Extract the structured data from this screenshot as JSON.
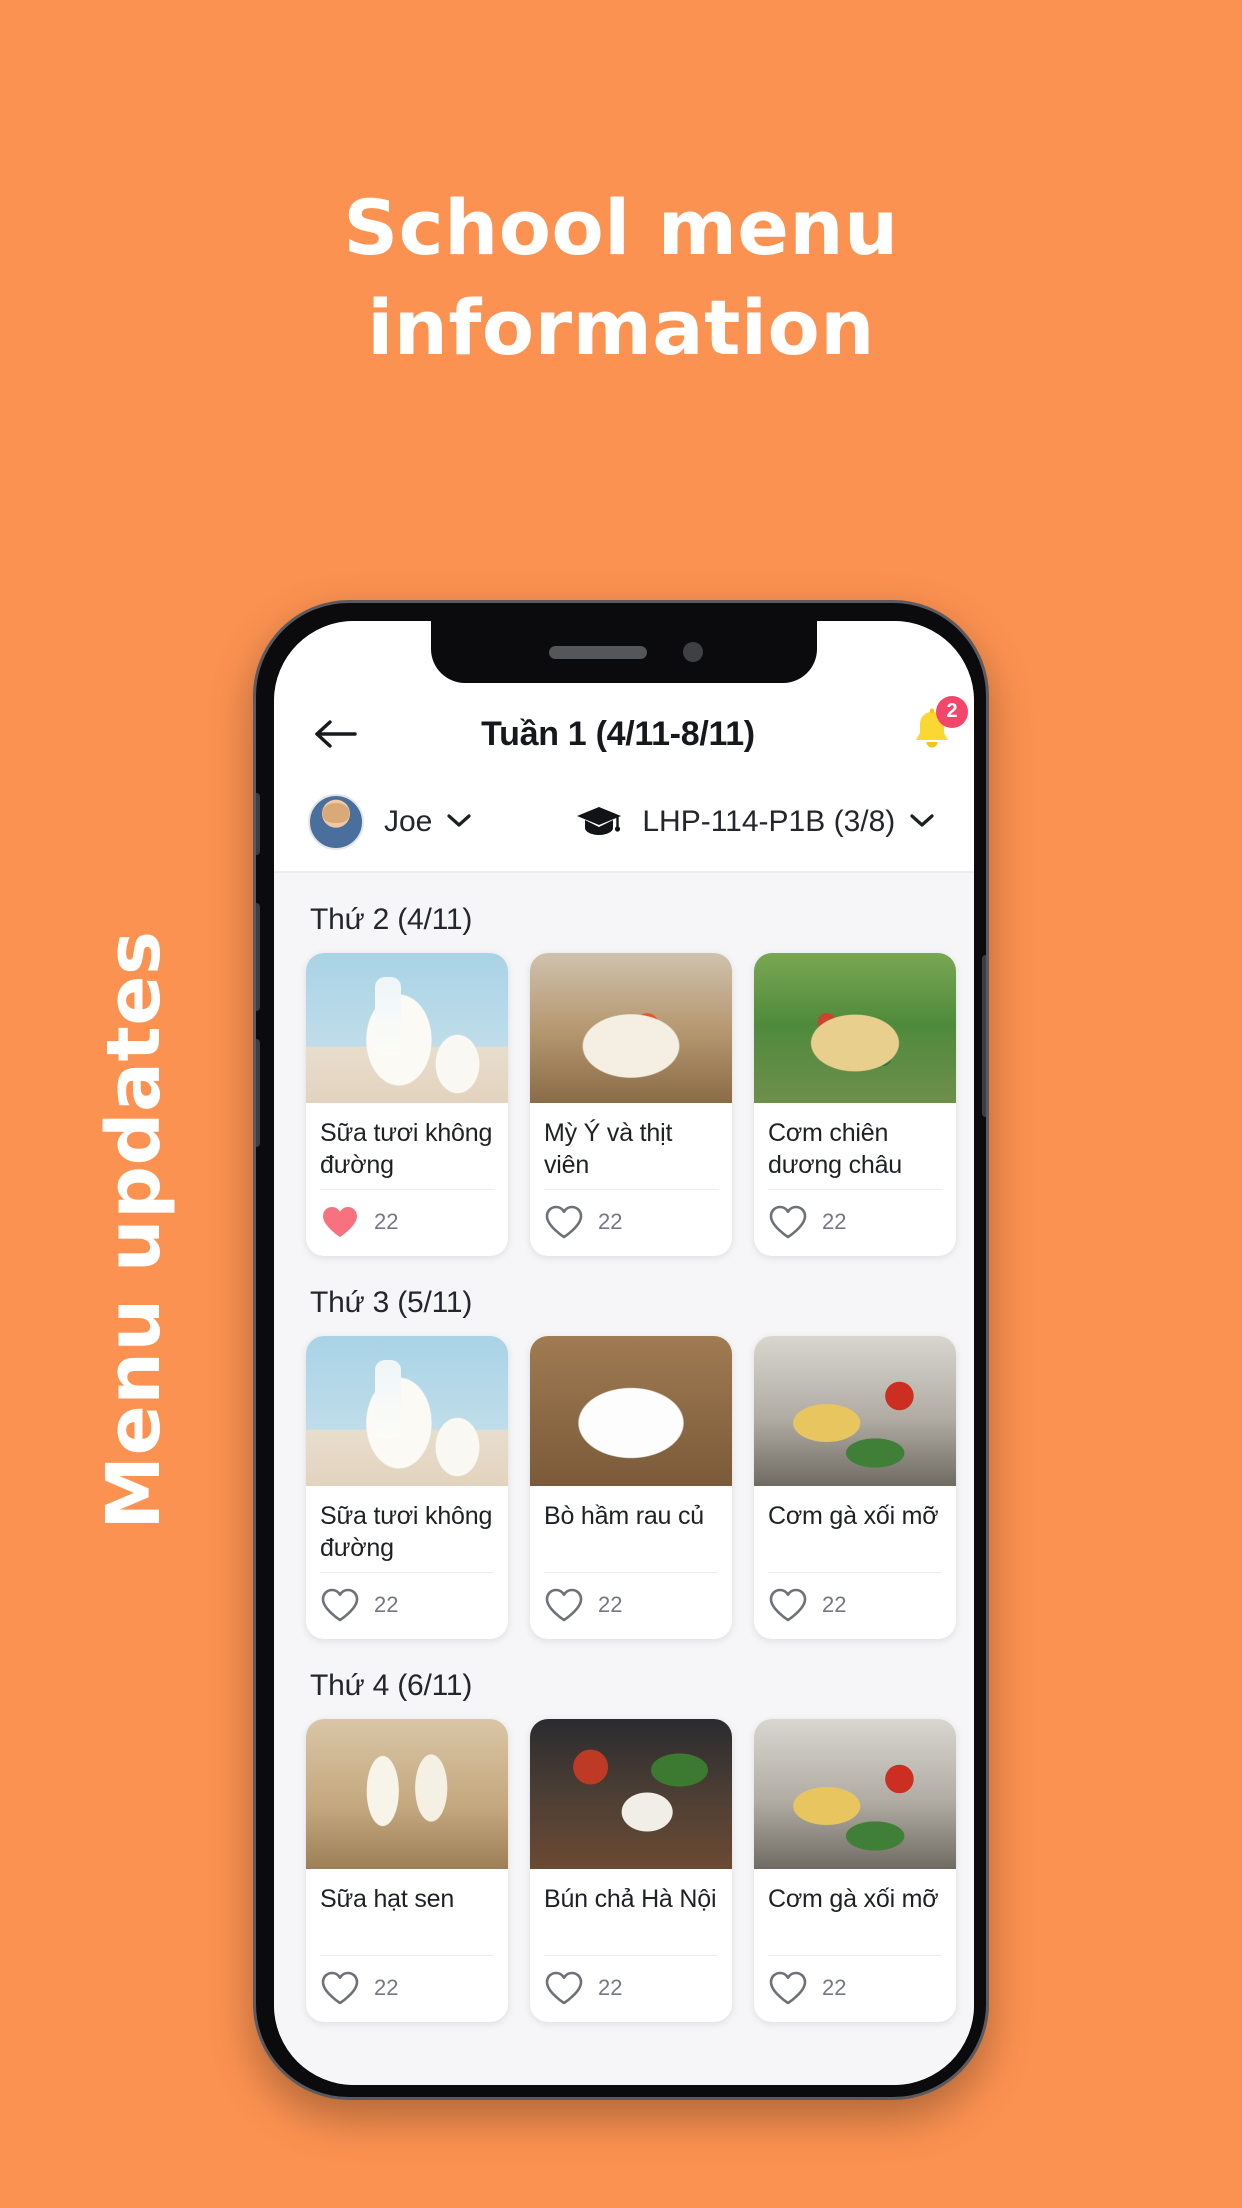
{
  "promo": {
    "title_line1": "School menu",
    "title_line2": "information",
    "side_caption": "Menu updates",
    "background_color": "#fc9251",
    "text_color": "#ffffff"
  },
  "app": {
    "header": {
      "back_icon": "arrow-left-icon",
      "title": "Tuần 1 (4/11-8/11)",
      "bell_icon": "bell-icon",
      "bell_badge": "2",
      "badge_color": "#f4456b"
    },
    "selectors": {
      "student": {
        "avatar_alt": "Joe avatar",
        "name": "Joe",
        "chevron": "chevron-down-icon"
      },
      "classroom": {
        "icon": "graduation-cap-icon",
        "label": "LHP-114-P1B (3/8)",
        "chevron": "chevron-down-icon"
      }
    },
    "days": [
      {
        "title": "Thứ 2 (4/11)",
        "items": [
          {
            "name": "Sữa tươi không đường",
            "likes": "22",
            "liked": true,
            "photo": "ph-milk"
          },
          {
            "name": "Mỳ Ý và thịt viên",
            "likes": "22",
            "liked": false,
            "photo": "ph-pasta"
          },
          {
            "name": "Cơm chiên dương châu",
            "likes": "22",
            "liked": false,
            "photo": "ph-rice"
          }
        ]
      },
      {
        "title": "Thứ 3 (5/11)",
        "items": [
          {
            "name": "Sữa tươi không đường",
            "likes": "22",
            "liked": false,
            "photo": "ph-milk"
          },
          {
            "name": "Bò hầm rau củ",
            "likes": "22",
            "liked": false,
            "photo": "ph-beef"
          },
          {
            "name": "Cơm gà xối mỡ",
            "likes": "22",
            "liked": false,
            "photo": "ph-chicken"
          }
        ]
      },
      {
        "title": "Thứ 4 (6/11)",
        "items": [
          {
            "name": "Sữa hạt sen",
            "likes": "22",
            "liked": false,
            "photo": "ph-soy"
          },
          {
            "name": "Bún chả Hà Nội",
            "likes": "22",
            "liked": false,
            "photo": "ph-bun"
          },
          {
            "name": "Cơm gà xối mỡ",
            "likes": "22",
            "liked": false,
            "photo": "ph-chicken"
          }
        ]
      }
    ],
    "liked_color": "#f8717e",
    "unliked_color": "#6e7177"
  }
}
